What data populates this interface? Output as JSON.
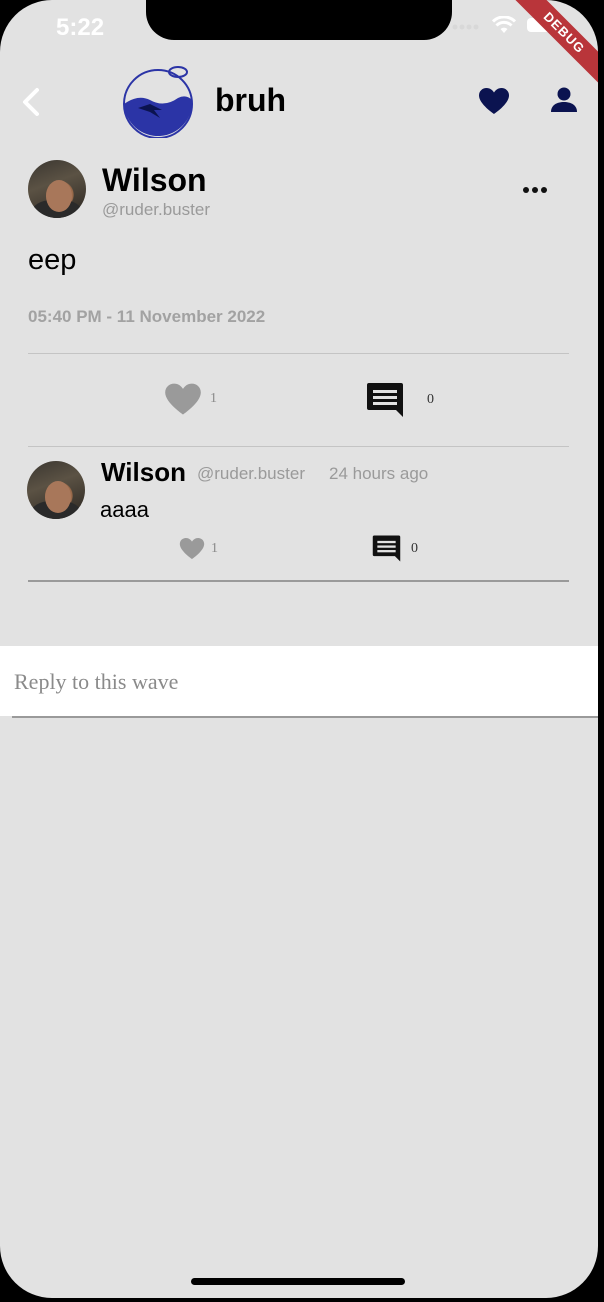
{
  "status_bar": {
    "time": "5:22",
    "debug_label": "DEBUG"
  },
  "app_bar": {
    "title": "bruh",
    "icons": [
      "back-icon",
      "fishbowl-logo",
      "heart-icon",
      "person-icon"
    ]
  },
  "post": {
    "author": "Wilson",
    "handle": "@ruder.buster",
    "body": "eep",
    "timestamp": "05:40 PM - 11 November 2022",
    "like_count": "1",
    "comment_count": "0"
  },
  "replies": [
    {
      "author": "Wilson",
      "handle": "@ruder.buster",
      "time": "24 hours ago",
      "text": "aaaa",
      "like_count": "1",
      "comment_count": "0"
    }
  ],
  "reply_input": {
    "placeholder": "Reply to this wave",
    "value": ""
  },
  "colors": {
    "navy": "#0b1350",
    "logo_blue": "#2b34a6",
    "background": "#e2e2e2",
    "like_grey": "#9a9a9a"
  }
}
